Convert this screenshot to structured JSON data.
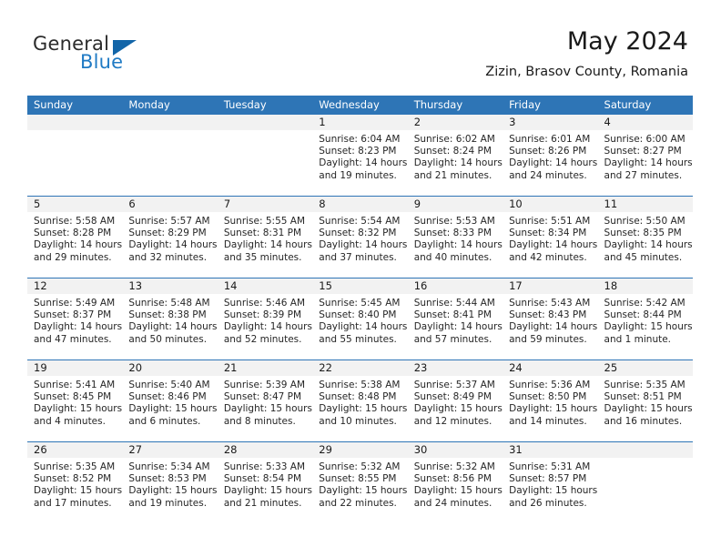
{
  "brand": {
    "name_part1": "General",
    "name_part2": "Blue",
    "triangle_color": "#1265a8",
    "blue_color": "#1f7ac4"
  },
  "header": {
    "title": "May 2024",
    "subtitle": "Zizin, Brasov County, Romania"
  },
  "theme": {
    "header_blue": "#2e75b6",
    "daynum_band": "#f2f2f2",
    "text": "#262626"
  },
  "labels": {
    "sunrise_prefix": "Sunrise:",
    "sunset_prefix": "Sunset:",
    "daylight_prefix": "Daylight:"
  },
  "weekdays": [
    "Sunday",
    "Monday",
    "Tuesday",
    "Wednesday",
    "Thursday",
    "Friday",
    "Saturday"
  ],
  "weeks": [
    [
      {
        "day": "",
        "sunrise": "",
        "sunset": "",
        "daylight_line1": "",
        "daylight_line2": ""
      },
      {
        "day": "",
        "sunrise": "",
        "sunset": "",
        "daylight_line1": "",
        "daylight_line2": ""
      },
      {
        "day": "",
        "sunrise": "",
        "sunset": "",
        "daylight_line1": "",
        "daylight_line2": ""
      },
      {
        "day": "1",
        "sunrise": "Sunrise: 6:04 AM",
        "sunset": "Sunset: 8:23 PM",
        "daylight_line1": "Daylight: 14 hours",
        "daylight_line2": "and 19 minutes."
      },
      {
        "day": "2",
        "sunrise": "Sunrise: 6:02 AM",
        "sunset": "Sunset: 8:24 PM",
        "daylight_line1": "Daylight: 14 hours",
        "daylight_line2": "and 21 minutes."
      },
      {
        "day": "3",
        "sunrise": "Sunrise: 6:01 AM",
        "sunset": "Sunset: 8:26 PM",
        "daylight_line1": "Daylight: 14 hours",
        "daylight_line2": "and 24 minutes."
      },
      {
        "day": "4",
        "sunrise": "Sunrise: 6:00 AM",
        "sunset": "Sunset: 8:27 PM",
        "daylight_line1": "Daylight: 14 hours",
        "daylight_line2": "and 27 minutes."
      }
    ],
    [
      {
        "day": "5",
        "sunrise": "Sunrise: 5:58 AM",
        "sunset": "Sunset: 8:28 PM",
        "daylight_line1": "Daylight: 14 hours",
        "daylight_line2": "and 29 minutes."
      },
      {
        "day": "6",
        "sunrise": "Sunrise: 5:57 AM",
        "sunset": "Sunset: 8:29 PM",
        "daylight_line1": "Daylight: 14 hours",
        "daylight_line2": "and 32 minutes."
      },
      {
        "day": "7",
        "sunrise": "Sunrise: 5:55 AM",
        "sunset": "Sunset: 8:31 PM",
        "daylight_line1": "Daylight: 14 hours",
        "daylight_line2": "and 35 minutes."
      },
      {
        "day": "8",
        "sunrise": "Sunrise: 5:54 AM",
        "sunset": "Sunset: 8:32 PM",
        "daylight_line1": "Daylight: 14 hours",
        "daylight_line2": "and 37 minutes."
      },
      {
        "day": "9",
        "sunrise": "Sunrise: 5:53 AM",
        "sunset": "Sunset: 8:33 PM",
        "daylight_line1": "Daylight: 14 hours",
        "daylight_line2": "and 40 minutes."
      },
      {
        "day": "10",
        "sunrise": "Sunrise: 5:51 AM",
        "sunset": "Sunset: 8:34 PM",
        "daylight_line1": "Daylight: 14 hours",
        "daylight_line2": "and 42 minutes."
      },
      {
        "day": "11",
        "sunrise": "Sunrise: 5:50 AM",
        "sunset": "Sunset: 8:35 PM",
        "daylight_line1": "Daylight: 14 hours",
        "daylight_line2": "and 45 minutes."
      }
    ],
    [
      {
        "day": "12",
        "sunrise": "Sunrise: 5:49 AM",
        "sunset": "Sunset: 8:37 PM",
        "daylight_line1": "Daylight: 14 hours",
        "daylight_line2": "and 47 minutes."
      },
      {
        "day": "13",
        "sunrise": "Sunrise: 5:48 AM",
        "sunset": "Sunset: 8:38 PM",
        "daylight_line1": "Daylight: 14 hours",
        "daylight_line2": "and 50 minutes."
      },
      {
        "day": "14",
        "sunrise": "Sunrise: 5:46 AM",
        "sunset": "Sunset: 8:39 PM",
        "daylight_line1": "Daylight: 14 hours",
        "daylight_line2": "and 52 minutes."
      },
      {
        "day": "15",
        "sunrise": "Sunrise: 5:45 AM",
        "sunset": "Sunset: 8:40 PM",
        "daylight_line1": "Daylight: 14 hours",
        "daylight_line2": "and 55 minutes."
      },
      {
        "day": "16",
        "sunrise": "Sunrise: 5:44 AM",
        "sunset": "Sunset: 8:41 PM",
        "daylight_line1": "Daylight: 14 hours",
        "daylight_line2": "and 57 minutes."
      },
      {
        "day": "17",
        "sunrise": "Sunrise: 5:43 AM",
        "sunset": "Sunset: 8:43 PM",
        "daylight_line1": "Daylight: 14 hours",
        "daylight_line2": "and 59 minutes."
      },
      {
        "day": "18",
        "sunrise": "Sunrise: 5:42 AM",
        "sunset": "Sunset: 8:44 PM",
        "daylight_line1": "Daylight: 15 hours",
        "daylight_line2": "and 1 minute."
      }
    ],
    [
      {
        "day": "19",
        "sunrise": "Sunrise: 5:41 AM",
        "sunset": "Sunset: 8:45 PM",
        "daylight_line1": "Daylight: 15 hours",
        "daylight_line2": "and 4 minutes."
      },
      {
        "day": "20",
        "sunrise": "Sunrise: 5:40 AM",
        "sunset": "Sunset: 8:46 PM",
        "daylight_line1": "Daylight: 15 hours",
        "daylight_line2": "and 6 minutes."
      },
      {
        "day": "21",
        "sunrise": "Sunrise: 5:39 AM",
        "sunset": "Sunset: 8:47 PM",
        "daylight_line1": "Daylight: 15 hours",
        "daylight_line2": "and 8 minutes."
      },
      {
        "day": "22",
        "sunrise": "Sunrise: 5:38 AM",
        "sunset": "Sunset: 8:48 PM",
        "daylight_line1": "Daylight: 15 hours",
        "daylight_line2": "and 10 minutes."
      },
      {
        "day": "23",
        "sunrise": "Sunrise: 5:37 AM",
        "sunset": "Sunset: 8:49 PM",
        "daylight_line1": "Daylight: 15 hours",
        "daylight_line2": "and 12 minutes."
      },
      {
        "day": "24",
        "sunrise": "Sunrise: 5:36 AM",
        "sunset": "Sunset: 8:50 PM",
        "daylight_line1": "Daylight: 15 hours",
        "daylight_line2": "and 14 minutes."
      },
      {
        "day": "25",
        "sunrise": "Sunrise: 5:35 AM",
        "sunset": "Sunset: 8:51 PM",
        "daylight_line1": "Daylight: 15 hours",
        "daylight_line2": "and 16 minutes."
      }
    ],
    [
      {
        "day": "26",
        "sunrise": "Sunrise: 5:35 AM",
        "sunset": "Sunset: 8:52 PM",
        "daylight_line1": "Daylight: 15 hours",
        "daylight_line2": "and 17 minutes."
      },
      {
        "day": "27",
        "sunrise": "Sunrise: 5:34 AM",
        "sunset": "Sunset: 8:53 PM",
        "daylight_line1": "Daylight: 15 hours",
        "daylight_line2": "and 19 minutes."
      },
      {
        "day": "28",
        "sunrise": "Sunrise: 5:33 AM",
        "sunset": "Sunset: 8:54 PM",
        "daylight_line1": "Daylight: 15 hours",
        "daylight_line2": "and 21 minutes."
      },
      {
        "day": "29",
        "sunrise": "Sunrise: 5:32 AM",
        "sunset": "Sunset: 8:55 PM",
        "daylight_line1": "Daylight: 15 hours",
        "daylight_line2": "and 22 minutes."
      },
      {
        "day": "30",
        "sunrise": "Sunrise: 5:32 AM",
        "sunset": "Sunset: 8:56 PM",
        "daylight_line1": "Daylight: 15 hours",
        "daylight_line2": "and 24 minutes."
      },
      {
        "day": "31",
        "sunrise": "Sunrise: 5:31 AM",
        "sunset": "Sunset: 8:57 PM",
        "daylight_line1": "Daylight: 15 hours",
        "daylight_line2": "and 26 minutes."
      },
      {
        "day": "",
        "sunrise": "",
        "sunset": "",
        "daylight_line1": "",
        "daylight_line2": ""
      }
    ]
  ]
}
